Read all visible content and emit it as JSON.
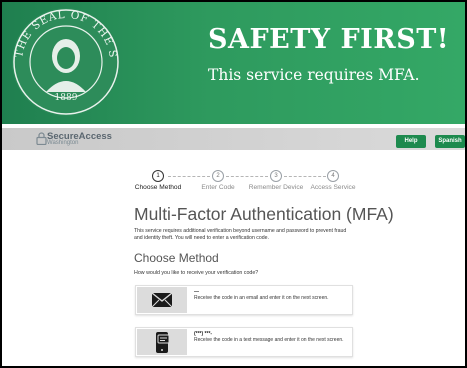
{
  "banner": {
    "title": "SAFETY FIRST!",
    "subtitle": "This service requires MFA.",
    "seal": {
      "top_text": "THE SEAL OF THE STATE OF WASHINGTON",
      "year": "1889"
    }
  },
  "nav": {
    "logo_text": "SecureAccess",
    "logo_subtext": "Washington",
    "help_label": "Help",
    "spanish_label": "Spanish"
  },
  "steps": [
    {
      "num": "1",
      "label": "Choose Method",
      "active": true
    },
    {
      "num": "2",
      "label": "Enter Code",
      "active": false
    },
    {
      "num": "3",
      "label": "Remember Device",
      "active": false
    },
    {
      "num": "4",
      "label": "Access Service",
      "active": false
    }
  ],
  "main": {
    "title": "Multi-Factor Authentication (MFA)",
    "description": "This service requires additional verification beyond username and password to prevent fraud and identity theft. You will need to enter a verification code.",
    "section_title": "Choose Method",
    "question": "How would you like to receive your verification code?",
    "options": [
      {
        "icon": "envelope-icon",
        "title": "—",
        "text": "Receive the code in an email and enter it on the next screen."
      },
      {
        "icon": "phone-message-icon",
        "title": "(***) ***-",
        "text": "Receive the code in a text message and enter it on the next screen."
      }
    ]
  },
  "colors": {
    "brand_green": "#2e9a5e",
    "button_green": "#1d8a4e",
    "nav_gray": "#d0d0d0"
  }
}
